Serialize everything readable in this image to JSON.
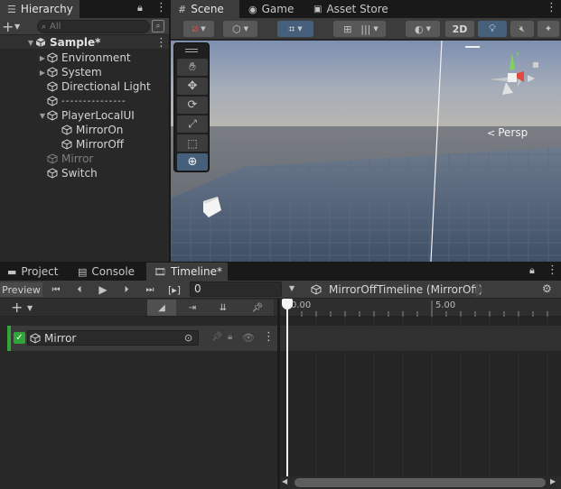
{
  "hierarchy": {
    "tab_label": "Hierarchy",
    "search_placeholder": "All",
    "scene_name": "Sample*",
    "items": [
      {
        "label": "Environment"
      },
      {
        "label": "System"
      },
      {
        "label": "Directional Light"
      },
      {
        "label": "- - - - - - - - - - - - - - -"
      },
      {
        "label": "PlayerLocalUI"
      },
      {
        "label": "MirrorOn"
      },
      {
        "label": "MirrorOff"
      },
      {
        "label": "Mirror"
      },
      {
        "label": "Switch"
      }
    ]
  },
  "scene": {
    "tabs": [
      {
        "label": "Scene"
      },
      {
        "label": "Game"
      },
      {
        "label": "Asset Store"
      }
    ],
    "btn_2d": "2D",
    "persp_label": "Persp"
  },
  "bottom": {
    "tabs": [
      {
        "label": "Project"
      },
      {
        "label": "Console"
      },
      {
        "label": "Timeline*"
      }
    ]
  },
  "timeline": {
    "preview_label": "Preview",
    "frame_value": "0",
    "marker_label": "[▸]",
    "asset_name": "MirrorOffTimeline (MirrorOff)",
    "ruler_labels": [
      "0.00",
      "5.00"
    ],
    "track_name": "Mirror",
    "track_enabled": true
  },
  "colors": {
    "accent_blue": "#46607c",
    "track_green": "#2fa53a",
    "sky": "#8a9bb8",
    "floor": "#4a5a70"
  }
}
